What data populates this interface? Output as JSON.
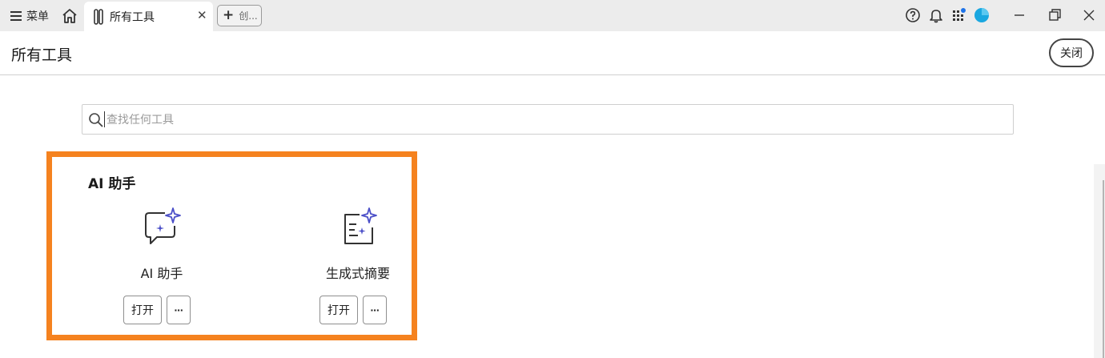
{
  "titlebar": {
    "menu_label": "菜单",
    "active_tab_title": "所有工具",
    "new_tab_label": "创...",
    "avatar_color": "#1aa7e0"
  },
  "header": {
    "title": "所有工具",
    "close_label": "关闭"
  },
  "search": {
    "placeholder": "查找任何工具"
  },
  "section": {
    "title": "AI 助手",
    "accent_color": "#f5821f",
    "tools": [
      {
        "name": "AI 助手",
        "icon": "chat-sparkle-icon",
        "open_label": "打开",
        "more_label": "···"
      },
      {
        "name": "生成式摘要",
        "icon": "document-sparkle-icon",
        "open_label": "打开",
        "more_label": "···"
      }
    ]
  }
}
